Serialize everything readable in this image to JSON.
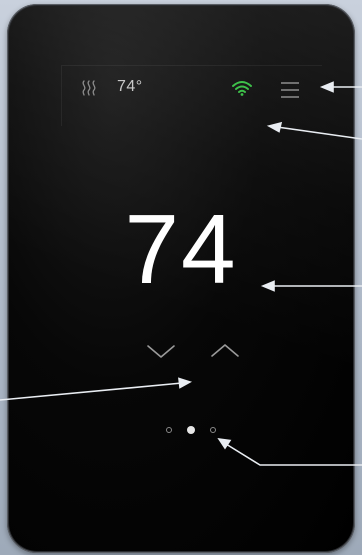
{
  "device": {
    "indoor_temperature": "74°",
    "setpoint": "74",
    "mode_icon": "heat-waves-icon",
    "wifi_icon": "wifi-icon",
    "menu_icon": "hamburger-menu-icon",
    "down_icon": "chevron-down-icon",
    "up_icon": "chevron-up-icon",
    "pages": {
      "count": 3,
      "active_index": 1
    }
  },
  "colors": {
    "screen": "#000000",
    "text_primary": "#ffffff",
    "text_secondary": "#c9c9c9",
    "wifi": "#3ec14a",
    "icon_gray": "#8d8d8d",
    "callout_line": "#e9edf2"
  }
}
